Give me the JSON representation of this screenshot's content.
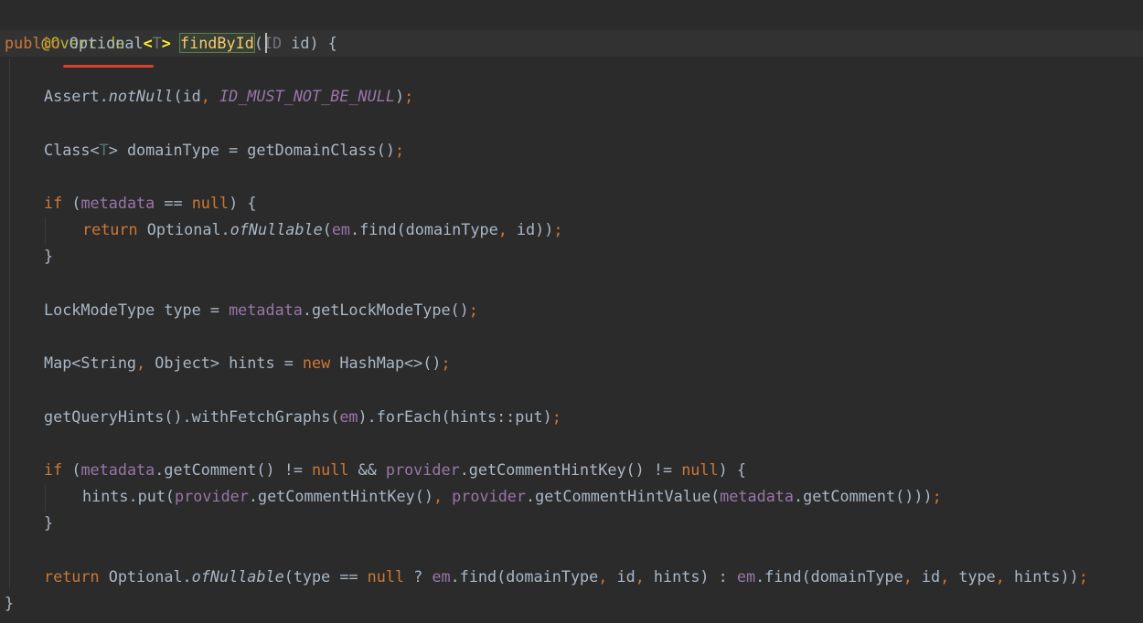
{
  "editor": {
    "annotation": "@Override",
    "signature": {
      "modifier": "public",
      "return_type": "Optional",
      "type_param_open": "<",
      "type_param": "T",
      "type_param_close": ">",
      "method_name": "findById",
      "open_paren": "(",
      "param_type": "ID",
      "param_name": " id) {"
    },
    "lines": {
      "assert": {
        "pre": "Assert.",
        "method": "notNull",
        "args_open": "(id",
        "comma": ",",
        "constant": " ID_MUST_NOT_BE_NULL",
        "close": ")",
        "semi": ";"
      },
      "class_decl": {
        "pre": "Class<",
        "type_param": "T",
        "post": "> domainType = getDomainClass()",
        "semi": ";"
      },
      "if1": {
        "kw": "if",
        "open": " (",
        "field": "metadata",
        "op": " == ",
        "null_kw": "null",
        "close": ") {"
      },
      "return1": {
        "kw": "return",
        "pre": " Optional.",
        "method": "ofNullable",
        "open": "(",
        "field": "em",
        "mid": ".find(domainType",
        "comma": ",",
        "post": " id))",
        "semi": ";"
      },
      "close_brace_1": "}",
      "lockmode": {
        "pre": "LockModeType type = ",
        "field": "metadata",
        "post": ".getLockModeType()",
        "semi": ";"
      },
      "hints_decl": {
        "pre": "Map<String",
        "comma": ",",
        "mid": " Object> hints = ",
        "new_kw": "new",
        "post": " HashMap<>()",
        "semi": ";"
      },
      "query_hints": {
        "pre": "getQueryHints().withFetchGraphs(",
        "field": "em",
        "post": ").forEach(hints::put)",
        "semi": ";"
      },
      "if2": {
        "kw": "if",
        "open": " (",
        "field1": "metadata",
        "mid1": ".getComment() != ",
        "null1": "null",
        "mid2": " && ",
        "field2": "provider",
        "mid3": ".getCommentHintKey() != ",
        "null2": "null",
        "close": ") {"
      },
      "hints_put": {
        "pre": "hints.put(",
        "field1": "provider",
        "mid1": ".getCommentHintKey()",
        "comma": ",",
        "sp": " ",
        "field2": "provider",
        "mid2": ".getCommentHintValue(",
        "field3": "metadata",
        "post": ".getComment()))",
        "semi": ";"
      },
      "close_brace_2": "}",
      "return2": {
        "kw": "return",
        "pre": " Optional.",
        "method": "ofNullable",
        "open": "(type == ",
        "null_kw": "null",
        "q": " ? ",
        "field1": "em",
        "mid1": ".find(domainType",
        "c1": ",",
        "mid2": " id",
        "c2": ",",
        "mid3": " hints) : ",
        "field2": "em",
        "mid4": ".find(domainType",
        "c3": ",",
        "mid5": " id",
        "c4": ",",
        "mid6": " type",
        "c5": ",",
        "post": " hints))",
        "semi": ";"
      },
      "final_brace": "}"
    }
  }
}
